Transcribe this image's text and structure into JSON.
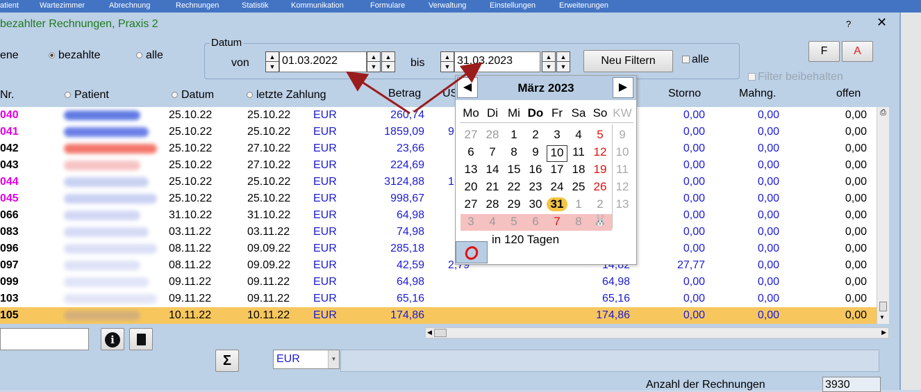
{
  "menu": [
    "atient",
    "Wartezimmer",
    "Abrechnung",
    "Rechnungen",
    "Statistik",
    "Kommunikation",
    "Formulare",
    "Verwaltung",
    "Einstellungen",
    "Erweiterungen"
  ],
  "window": {
    "title": "bezahlter Rechnungen, Praxis 2",
    "help": "?",
    "close": "✕"
  },
  "filters": {
    "partial_label": "ene",
    "bezahlte": "bezahlte",
    "alle": "alle",
    "datum_legend": "Datum",
    "von": "von",
    "bis": "bis",
    "from_date": "01.03.2022",
    "to_date": "31.03.2023",
    "neu_filtern": "Neu Filtern",
    "alle_check": "alle",
    "filter_beibehalten": "Filter beibehalten",
    "btn_f": "F",
    "btn_a": "A"
  },
  "columns": {
    "nr": "Nr.",
    "patient": "Patient",
    "datum": "Datum",
    "letzte_zahlung": "letzte Zahlung",
    "betrag": "Betrag",
    "ust": "US",
    "storno": "Storno",
    "mahng": "Mahng.",
    "offen": "offen"
  },
  "rows": [
    {
      "nr": "040",
      "nr_color": "#e000e0",
      "datum": "25.10.22",
      "zahlung": "25.10.22",
      "cur": "EUR",
      "betrag": "260,74",
      "ust": "",
      "bezahlt": "",
      "storno": "0,00",
      "mahng": "0,00",
      "offen": "0,00",
      "blur": "#2b4fd9"
    },
    {
      "nr": "041",
      "nr_color": "#e000e0",
      "datum": "25.10.22",
      "zahlung": "25.10.22",
      "cur": "EUR",
      "betrag": "1859,09",
      "ust": "9",
      "bezahlt": "",
      "storno": "0,00",
      "mahng": "0,00",
      "offen": "0,00",
      "blur": "#3a55e0"
    },
    {
      "nr": "042",
      "nr_color": "#000000",
      "datum": "25.10.22",
      "zahlung": "27.10.22",
      "cur": "EUR",
      "betrag": "23,66",
      "ust": "",
      "bezahlt": "",
      "storno": "0,00",
      "mahng": "0,00",
      "offen": "0,00",
      "blur": "#f04a3a"
    },
    {
      "nr": "043",
      "nr_color": "#000000",
      "datum": "25.10.22",
      "zahlung": "27.10.22",
      "cur": "EUR",
      "betrag": "224,69",
      "ust": "",
      "bezahlt": "",
      "storno": "0,00",
      "mahng": "0,00",
      "offen": "0,00",
      "blur": "#f3b0b0"
    },
    {
      "nr": "044",
      "nr_color": "#e000e0",
      "datum": "25.10.22",
      "zahlung": "25.10.22",
      "cur": "EUR",
      "betrag": "3124,88",
      "ust": "1(",
      "bezahlt": "",
      "storno": "0,00",
      "mahng": "0,00",
      "offen": "0,00",
      "blur": "#b8c2ee"
    },
    {
      "nr": "045",
      "nr_color": "#e000e0",
      "datum": "25.10.22",
      "zahlung": "25.10.22",
      "cur": "EUR",
      "betrag": "998,67",
      "ust": "",
      "bezahlt": "",
      "storno": "0,00",
      "mahng": "0,00",
      "offen": "0,00",
      "blur": "#b8c2ee"
    },
    {
      "nr": "066",
      "nr_color": "#000000",
      "datum": "31.10.22",
      "zahlung": "31.10.22",
      "cur": "EUR",
      "betrag": "64,98",
      "ust": "",
      "bezahlt": "",
      "storno": "0,00",
      "mahng": "0,00",
      "offen": "0,00",
      "blur": "#c2caf0"
    },
    {
      "nr": "083",
      "nr_color": "#000000",
      "datum": "03.11.22",
      "zahlung": "03.11.22",
      "cur": "EUR",
      "betrag": "74,98",
      "ust": "",
      "bezahlt": "",
      "storno": "0,00",
      "mahng": "0,00",
      "offen": "0,00",
      "blur": "#c8cff2"
    },
    {
      "nr": "096",
      "nr_color": "#000000",
      "datum": "08.11.22",
      "zahlung": "09.09.22",
      "cur": "EUR",
      "betrag": "285,18",
      "ust": "",
      "bezahlt": "",
      "storno": "0,00",
      "mahng": "0,00",
      "offen": "0,00",
      "blur": "#cfd5f3"
    },
    {
      "nr": "097",
      "nr_color": "#000000",
      "datum": "08.11.22",
      "zahlung": "09.09.22",
      "cur": "EUR",
      "betrag": "42,59",
      "ust": "2,79",
      "bezahlt": "14,82",
      "storno": "27,77",
      "mahng": "0,00",
      "offen": "0,00",
      "blur": "#d3d8f4"
    },
    {
      "nr": "099",
      "nr_color": "#000000",
      "datum": "09.11.22",
      "zahlung": "09.11.22",
      "cur": "EUR",
      "betrag": "64,98",
      "ust": "",
      "bezahlt": "64,98",
      "storno": "0,00",
      "mahng": "0,00",
      "offen": "0,00",
      "blur": "#d6dbf5"
    },
    {
      "nr": "103",
      "nr_color": "#000000",
      "datum": "09.11.22",
      "zahlung": "09.11.22",
      "cur": "EUR",
      "betrag": "65,16",
      "ust": "",
      "bezahlt": "65,16",
      "storno": "0,00",
      "mahng": "0,00",
      "offen": "0,00",
      "blur": "#d9ddf5"
    },
    {
      "nr": "105",
      "nr_color": "#000000",
      "datum": "10.11.22",
      "zahlung": "10.11.22",
      "cur": "EUR",
      "betrag": "174,86",
      "ust": "",
      "bezahlt": "174,86",
      "storno": "0,00",
      "mahng": "0,00",
      "offen": "0,00",
      "blur": "#c9a882",
      "selected": true
    }
  ],
  "calendar": {
    "title": "März 2023",
    "prev": "◀",
    "next": "▶",
    "weekdays": [
      "Mo",
      "Di",
      "Mi",
      "Do",
      "Fr",
      "Sa",
      "So",
      "KW"
    ],
    "weeks": [
      {
        "days": [
          "27",
          "28",
          "1",
          "2",
          "3",
          "4",
          "5"
        ],
        "kw": "9"
      },
      {
        "days": [
          "6",
          "7",
          "8",
          "9",
          "10",
          "11",
          "12"
        ],
        "kw": "10"
      },
      {
        "days": [
          "13",
          "14",
          "15",
          "16",
          "17",
          "18",
          "19"
        ],
        "kw": "11"
      },
      {
        "days": [
          "20",
          "21",
          "22",
          "23",
          "24",
          "25",
          "26"
        ],
        "kw": "12"
      },
      {
        "days": [
          "27",
          "28",
          "29",
          "30",
          "31",
          "1",
          "2"
        ],
        "kw": "13"
      },
      {
        "days": [
          "3",
          "4",
          "5",
          "6",
          "7",
          "8",
          ""
        ],
        "kw": ""
      }
    ],
    "footer": "in 120 Tagen",
    "colors": {
      "today": "#f4c542",
      "sunday": "#e01010",
      "outside": "#9a9a9a"
    }
  },
  "bottom": {
    "currency": "EUR",
    "sigma": "Σ",
    "count_label": "Anzahl der Rechnungen",
    "count": "3930"
  },
  "icons": {
    "info": "info-icon",
    "doc": "document-icon",
    "print": "print-icon",
    "bunny": "bunny-icon",
    "today_ring": "today-ring-icon"
  }
}
